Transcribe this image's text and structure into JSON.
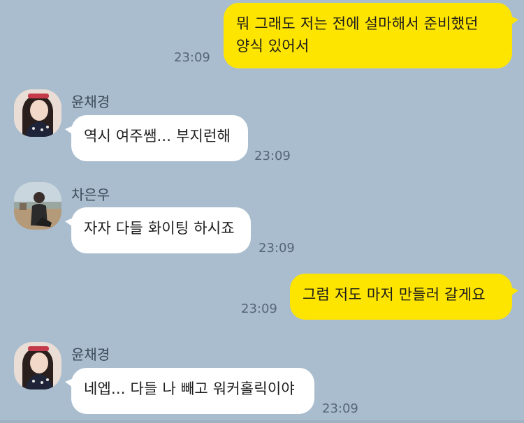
{
  "messages": [
    {
      "kind": "mine",
      "text": "뭐 그래도 저는 전에 설마해서 준비했던\n양식 있어서",
      "time": "23:09"
    },
    {
      "kind": "theirs",
      "sender": "윤채경",
      "text": "역시 여주쌤... 부지런해",
      "time": "23:09"
    },
    {
      "kind": "theirs",
      "sender": "차은우",
      "text": "자자 다들 화이팅 하시죠",
      "time": "23:09"
    },
    {
      "kind": "mine",
      "text": "그럼 저도 마저 만들러 갈게요",
      "time": "23:09"
    },
    {
      "kind": "theirs",
      "sender": "윤채경",
      "text": "네엡... 다들 나 빼고 워커홀릭이야",
      "time": "23:09"
    }
  ],
  "colors": {
    "background": "#a9bdce",
    "mine_bubble": "#fee500",
    "theirs_bubble": "#ffffff"
  },
  "icons": {
    "avatar_1": "profile-photo-woman",
    "avatar_2": "profile-photo-man-outdoor"
  }
}
